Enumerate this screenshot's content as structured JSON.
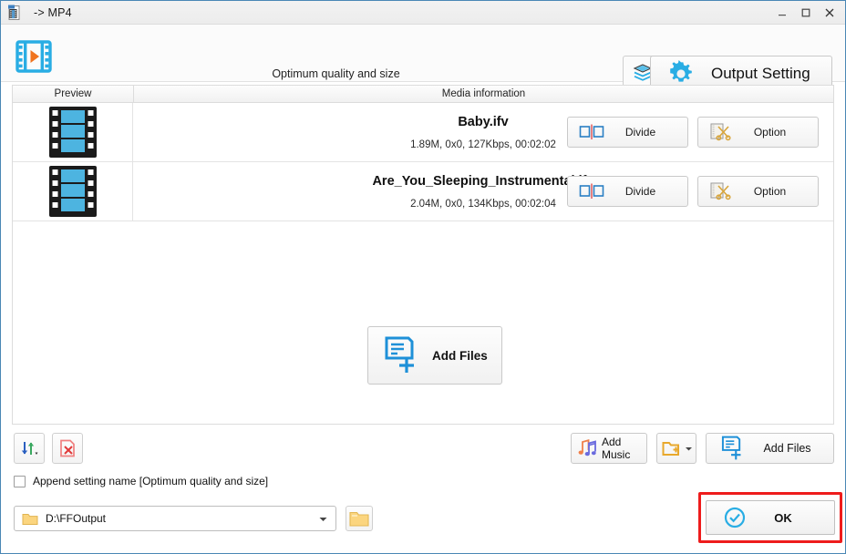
{
  "window": {
    "title": "-> MP4",
    "app_icon": "video-file-icon",
    "controls": {
      "minimize": "—",
      "maximize": "☐",
      "close": "✕"
    }
  },
  "header": {
    "logo_icon": "film-play-icon",
    "subtitle": "Optimum quality and size",
    "layers_button": {
      "icon": "layers-icon",
      "label": ""
    },
    "output_setting": {
      "icon": "gear-icon",
      "label": "Output Setting"
    }
  },
  "table": {
    "columns": [
      "Preview",
      "Media information"
    ],
    "rows": [
      {
        "thumbnail_icon": "film-strip-icon",
        "name": "Baby.ifv",
        "meta": "1.89M, 0x0, 127Kbps, 00:02:02",
        "divide_label": "Divide",
        "divide_icon": "divide-icon",
        "option_label": "Option",
        "option_icon": "scissors-icon"
      },
      {
        "thumbnail_icon": "film-strip-icon",
        "name": "Are_You_Sleeping_Instrumental.ifv",
        "meta": "2.04M, 0x0, 134Kbps, 00:02:04",
        "divide_label": "Divide",
        "divide_icon": "divide-icon",
        "option_label": "Option",
        "option_icon": "scissors-icon"
      }
    ],
    "add_files_center": {
      "icon": "add-file-icon",
      "label": "Add Files"
    }
  },
  "bottom": {
    "sort_button": {
      "icon": "sort-arrows-icon",
      "label": ""
    },
    "clear_button": {
      "icon": "remove-file-icon",
      "label": ""
    },
    "add_music": {
      "icon": "music-notes-icon",
      "label": "Add Music"
    },
    "add_folder": {
      "icon": "add-folder-icon",
      "label": ""
    },
    "add_files": {
      "icon": "add-file-icon",
      "label": "Add Files"
    },
    "append_setting": {
      "checked": false,
      "label": "Append setting name [Optimum quality and size]"
    },
    "output_path": {
      "icon": "folder-icon",
      "value": "D:\\FFOutput",
      "dropdown_icon": "chevron-down-icon"
    },
    "browse_button": {
      "icon": "folder-icon",
      "label": ""
    },
    "ok_button": {
      "icon": "check-circle-icon",
      "label": "OK"
    }
  },
  "colors": {
    "accent": "#29ade4",
    "highlight_border": "#ee1c1c",
    "orange": "#f08020",
    "yellow": "#f5c542"
  }
}
